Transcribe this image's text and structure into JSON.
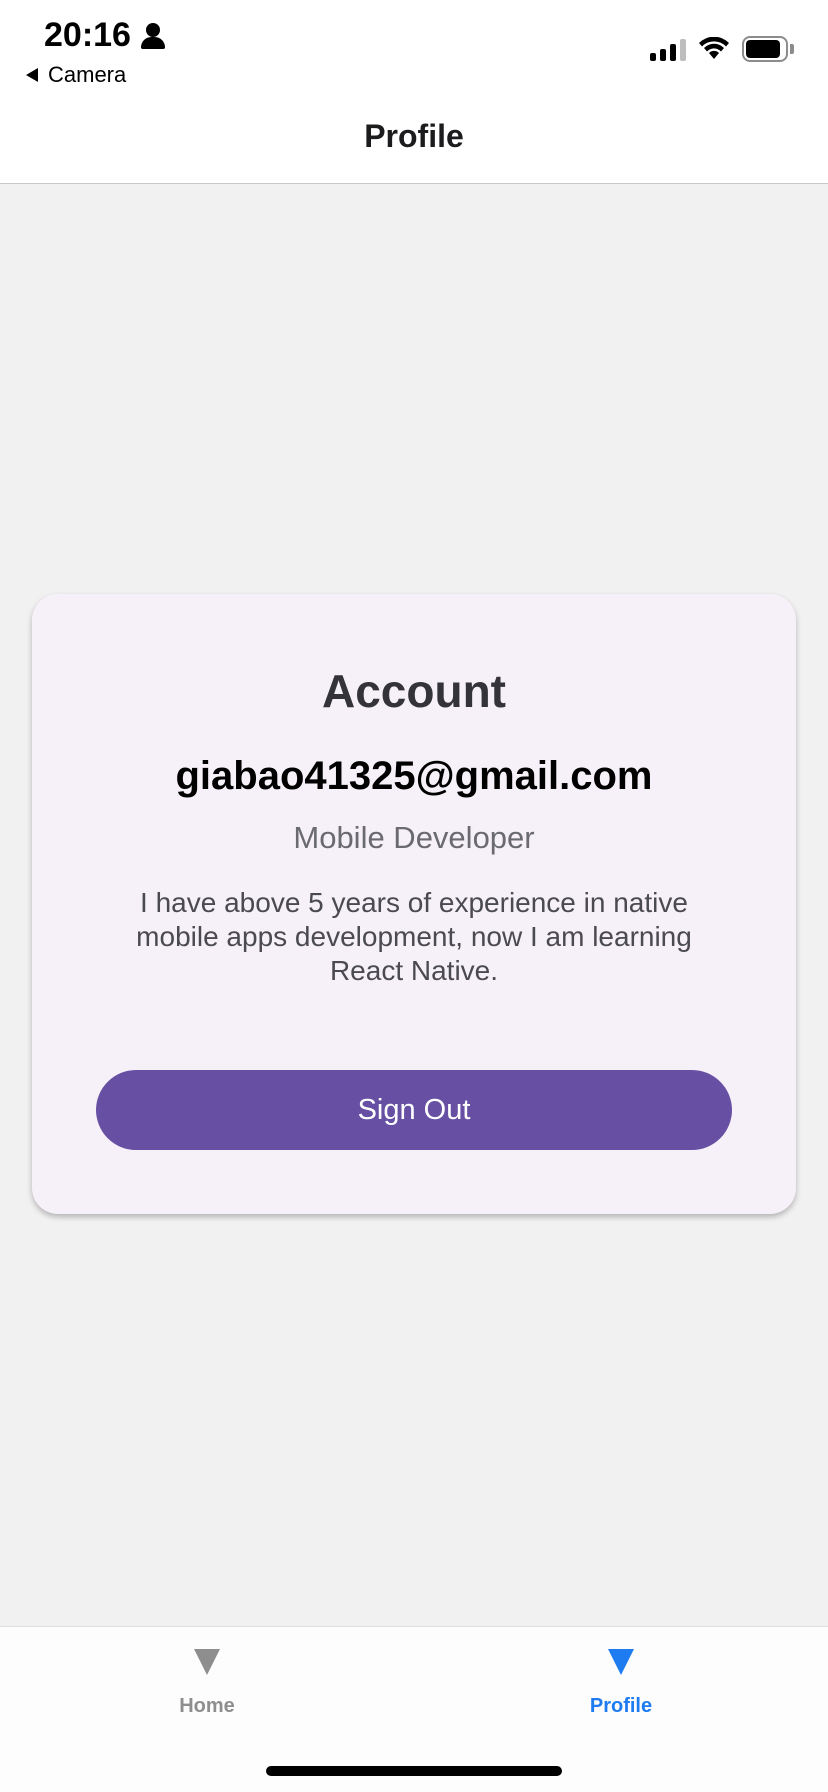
{
  "status_bar": {
    "time": "20:16",
    "back_app": "Camera"
  },
  "header": {
    "title": "Profile"
  },
  "card": {
    "title": "Account",
    "email": "giabao41325@gmail.com",
    "role": "Mobile Developer",
    "bio": "I have above 5 years of experience in native mobile apps development, now I am learning React Native.",
    "sign_out_label": "Sign Out",
    "button_color": "#6750a4"
  },
  "tabs": [
    {
      "label": "Home",
      "icon": "triangle-down-icon",
      "active": false
    },
    {
      "label": "Profile",
      "icon": "triangle-down-icon",
      "active": true
    }
  ],
  "colors": {
    "accent": "#1e7cf0",
    "inactive": "#8e8e8e"
  }
}
